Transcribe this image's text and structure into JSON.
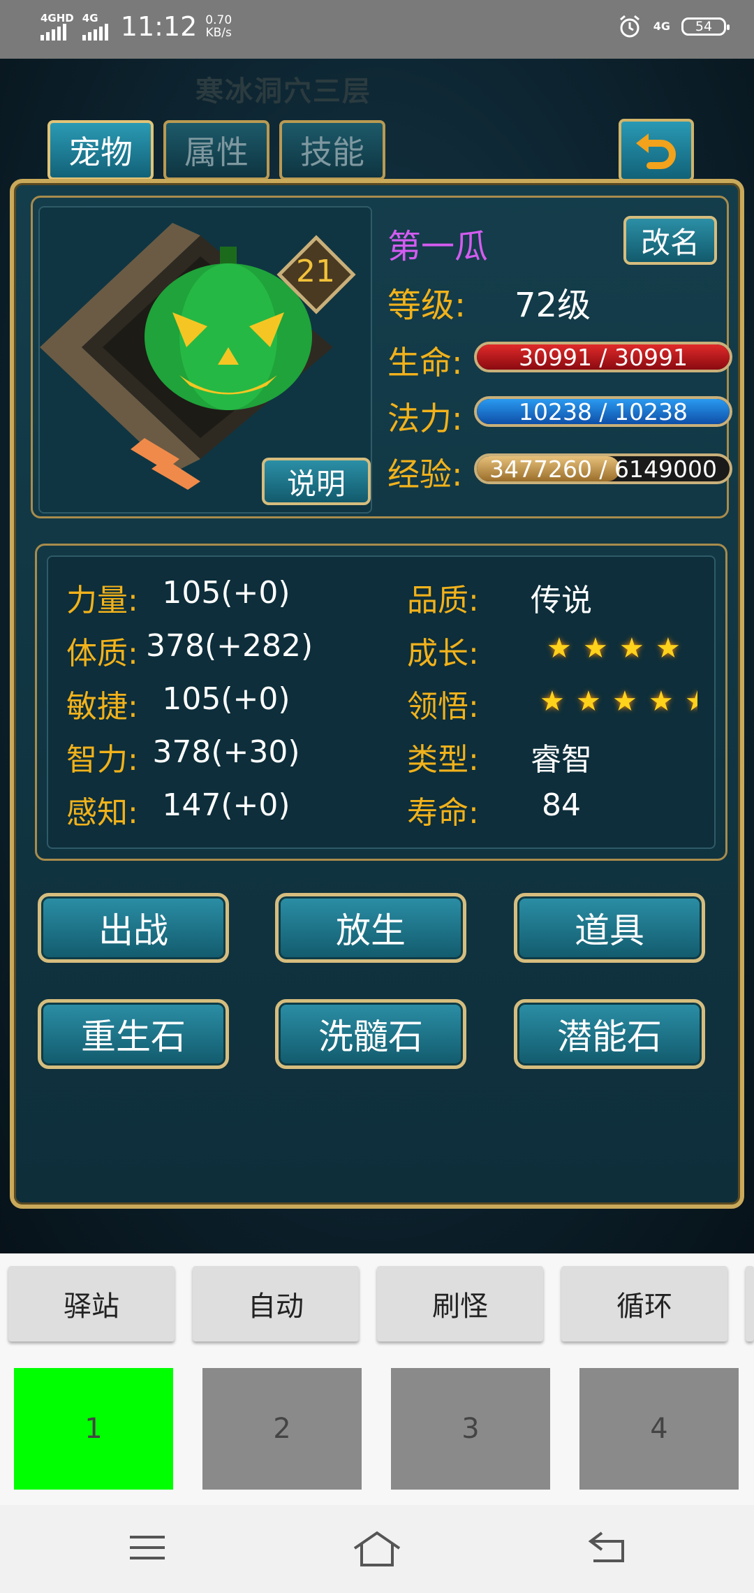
{
  "status_bar": {
    "signal1_label": "4GHD",
    "signal2_label": "4G",
    "time": "11:12",
    "speed_value": "0.70",
    "speed_unit": "KB/s",
    "net_label": "4G",
    "battery": "54"
  },
  "game": {
    "map_title": "寒冰洞穴三层",
    "tabs": [
      "宠物",
      "属性",
      "技能"
    ],
    "active_tab": 0,
    "pet": {
      "name": "第一瓜",
      "rename_label": "改名",
      "explain_label": "说明",
      "portrait_level": "21",
      "level_label": "等级:",
      "level_value": "72级",
      "hp_label": "生命:",
      "hp_text": "30991 / 30991",
      "hp_fraction": 1.0,
      "mp_label": "法力:",
      "mp_text": "10238 / 10238",
      "mp_fraction": 1.0,
      "exp_label": "经验:",
      "exp_text": "3477260 / 6149000",
      "exp_fraction": 0.5655
    },
    "stats_left": [
      {
        "label": "力量:",
        "value": "105(+0)"
      },
      {
        "label": "体质:",
        "value": "378(+282)"
      },
      {
        "label": "敏捷:",
        "value": "105(+0)"
      },
      {
        "label": "智力:",
        "value": "378(+30)"
      },
      {
        "label": "感知:",
        "value": "147(+0)"
      }
    ],
    "stats_right": {
      "quality_label": "品质:",
      "quality_value": "传说",
      "growth_label": "成长:",
      "growth_stars": 4,
      "comprehension_label": "领悟:",
      "comprehension_stars": 4.5,
      "type_label": "类型:",
      "type_value": "睿智",
      "lifespan_label": "寿命:",
      "lifespan_value": "84"
    },
    "action_buttons": [
      "出战",
      "放生",
      "道具",
      "重生石",
      "洗髓石",
      "潜能石"
    ]
  },
  "bottom": {
    "quick_buttons": [
      "驿站",
      "自动",
      "刷怪",
      "循环"
    ],
    "slots": [
      "1",
      "2",
      "3",
      "4"
    ],
    "active_slot": 0,
    "colors": {
      "slot_active": "#00ff00",
      "slot_inactive": "#8a8a8a"
    }
  },
  "colors": {
    "hp_bar": "#c0121a",
    "mp_bar": "#1a78d8",
    "exp_bar": "#c99a4a",
    "gold_label": "#f2b21b",
    "pet_name": "#d35cf0"
  },
  "nav": {
    "icons": [
      "menu-icon",
      "home-icon",
      "back-icon"
    ]
  }
}
